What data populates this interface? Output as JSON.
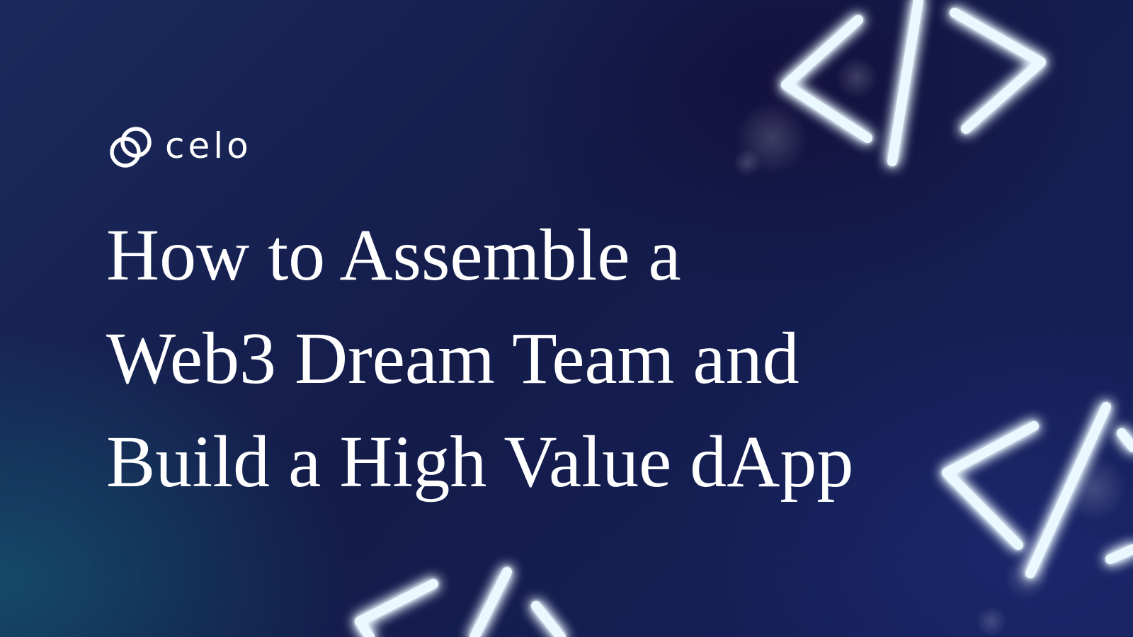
{
  "brand": {
    "name": "celo",
    "icon": "celo-logo-icon"
  },
  "headline": {
    "lines": [
      "How to Assemble a",
      "Web3 Dream Team and",
      "Build a High Value dApp"
    ]
  },
  "decorations": {
    "icon": "code-brackets-icon",
    "neon_color": "#7fd0ff",
    "core_color": "#eaf8ff"
  },
  "colors": {
    "background": "#141c4a",
    "text": "#ffffff"
  }
}
